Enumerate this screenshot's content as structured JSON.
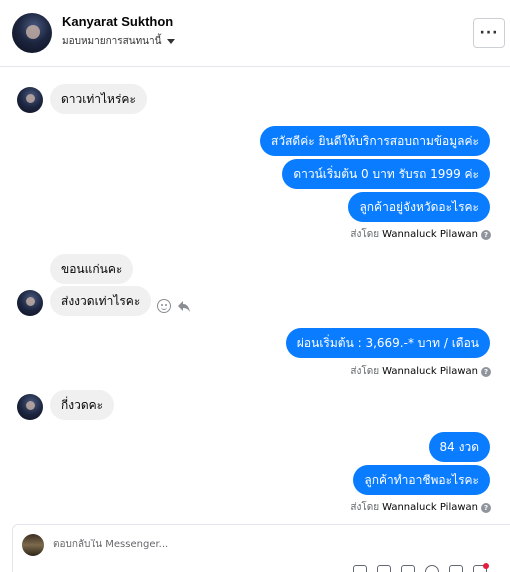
{
  "header": {
    "name": "Kanyarat Sukthon",
    "assign_label": "มอบหมายการสนทนานี้",
    "more_label": "···"
  },
  "messages": {
    "m1": "ดาวเท่าไหร่คะ",
    "m2": "สวัสดีค่ะ  ยินดีให้บริการสอบถามข้อมูลค่ะ",
    "m3": "ดาวน์เริ่มต้น 0 บาท รับรถ 1999 ค่ะ",
    "m4": "ลูกค้าอยู่จังหวัดอะไรคะ",
    "m5": "ขอนแก่นคะ",
    "m6": "ส่งงวดเท่าไรคะ",
    "m7": "ผ่อนเริ่มต้น : 3,669.-* บาท / เดือน",
    "m8": "กี่งวดคะ",
    "m9": "84 งวด",
    "m10": "ลูกค้าทำอาชีพอะไรคะ"
  },
  "sent_by": {
    "prefix": "ส่งโดย",
    "name": "Wannaluck Pilawan",
    "info_glyph": "?"
  },
  "composer": {
    "placeholder": "ตอบกลับใน Messenger..."
  },
  "colors": {
    "outgoing": "#0a7cff",
    "incoming": "#f0f0f0"
  }
}
